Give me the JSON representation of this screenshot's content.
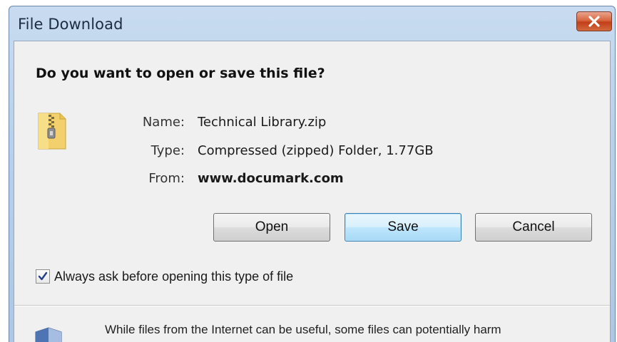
{
  "window": {
    "title": "File Download"
  },
  "dialog": {
    "question": "Do you want to open or save this file?",
    "file": {
      "name_label": "Name:",
      "name_value": "Technical Library.zip",
      "type_label": "Type:",
      "type_value": "Compressed (zipped) Folder, 1.77GB",
      "from_label": "From:",
      "from_value": "www.documark.com"
    },
    "buttons": {
      "open": "Open",
      "save": "Save",
      "cancel": "Cancel"
    },
    "always_ask": {
      "checked": true,
      "label": "Always ask before opening this type of file"
    },
    "warning": "While files from the Internet can be useful, some files can potentially harm"
  },
  "icons": {
    "close": "close-icon",
    "file": "zip-folder-icon",
    "security": "shield-icon",
    "check": "checkmark-icon"
  },
  "colors": {
    "close_button": "#c8441d",
    "default_button": "#bee6fd",
    "titlebar": "#bad1ea",
    "client_bg": "#f0f0f0"
  }
}
